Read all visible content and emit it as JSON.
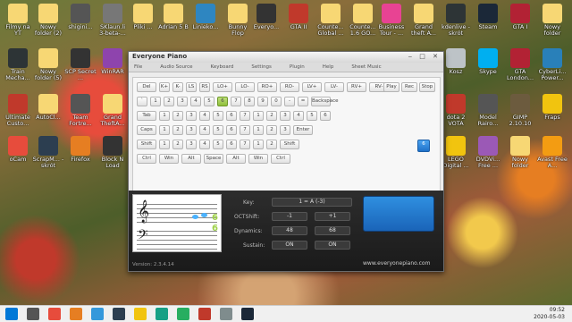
{
  "desktop": {
    "icons": [
      {
        "label": "Filmy na YT",
        "color": "#f7d774"
      },
      {
        "label": "Nowy folder (2)",
        "color": "#f7d774"
      },
      {
        "label": "shigini...",
        "color": "#555"
      },
      {
        "label": "SKlaun.li 3-beta-...",
        "color": "#777"
      },
      {
        "label": "Pliki ...",
        "color": "#f7d774"
      },
      {
        "label": "Adrian 5 B",
        "color": "#f7d774"
      },
      {
        "label": "Linieko...",
        "color": "#2e86c1"
      },
      {
        "label": "Bunny Flop",
        "color": "#f7d774"
      },
      {
        "label": "Everyo...",
        "color": "#333"
      },
      {
        "label": "GTA II",
        "color": "#c0392b"
      },
      {
        "label": "Counte... Global ...",
        "color": "#f7d774"
      },
      {
        "label": "Counte... 1.6 GO...",
        "color": "#f7d774"
      },
      {
        "label": "Business Tour - ...",
        "color": "#e84393"
      },
      {
        "label": "Grand theft A...",
        "color": "#f7d774"
      },
      {
        "label": "kdenlive - skrót",
        "color": "#2d3436"
      },
      {
        "label": "Steam",
        "color": "#1b2838"
      },
      {
        "label": "GTA I",
        "color": "#b22234"
      },
      {
        "label": "Nowy folder",
        "color": "#f7d774"
      },
      {
        "label": "Train Mecha...",
        "color": "#2d3436"
      },
      {
        "label": "Nowy folder (5)",
        "color": "#f7d774"
      },
      {
        "label": "SCP Secret ...",
        "color": "#333"
      },
      {
        "label": "WinRAR",
        "color": "#8e44ad"
      },
      {
        "label": "Kosz",
        "color": "#bdc3c7"
      },
      {
        "label": "Skype",
        "color": "#00aff0"
      },
      {
        "label": "GTA London...",
        "color": "#b22234"
      },
      {
        "label": "CyberLi... Power...",
        "color": "#2980b9"
      },
      {
        "label": "Ultimate Custo...",
        "color": "#c0392b"
      },
      {
        "label": "AutoCl...",
        "color": "#f7d774"
      },
      {
        "label": "Team Fortre...",
        "color": "#555"
      },
      {
        "label": "Grand TheftA...",
        "color": "#f7d774"
      },
      {
        "label": "dota 2 VOTA",
        "color": "#c0392b"
      },
      {
        "label": "Model Rairo...",
        "color": "#555"
      },
      {
        "label": "GIMP 2.10.10",
        "color": "#6c5b3e"
      },
      {
        "label": "Fraps",
        "color": "#f1c40f"
      },
      {
        "label": "oCam",
        "color": "#e74c3c"
      },
      {
        "label": "ScrapM... - skrót",
        "color": "#2c3e50"
      },
      {
        "label": "Firefox",
        "color": "#e67e22"
      },
      {
        "label": "Block N Load",
        "color": "#333"
      },
      {
        "label": "LEGO Digital ...",
        "color": "#f1c40f"
      },
      {
        "label": "DVDVi... Free ...",
        "color": "#9b59b6"
      },
      {
        "label": "Nowy folder",
        "color": "#f7d774"
      },
      {
        "label": "Avast Free A...",
        "color": "#f39c12"
      }
    ]
  },
  "piano": {
    "logo": "Everyone Piano",
    "window_controls": "‒ □ ✕",
    "menu": [
      "File",
      "Audio Source",
      "Keyboard",
      "Settings",
      "Plugin",
      "Help",
      "Sheet Music"
    ],
    "rows": [
      [
        "Del",
        "K+",
        "K-",
        "LS",
        "RS",
        "LO+",
        "LO-",
        "RO+",
        "RO-",
        "LV+",
        "LV-",
        "RV+",
        "RV-"
      ],
      [
        "`",
        "1",
        "2",
        "3",
        "4",
        "5",
        "6",
        "7",
        "8",
        "9",
        "0",
        "-",
        "=",
        "Backspace"
      ],
      [
        "Tab",
        "1",
        "2",
        "3",
        "4",
        "5",
        "6",
        "7",
        "1",
        "2",
        "3",
        "4",
        "5",
        "6"
      ],
      [
        "Caps",
        "1",
        "2",
        "3",
        "4",
        "5",
        "6",
        "7",
        "1",
        "2",
        "3",
        "Enter"
      ],
      [
        "Shift",
        "1",
        "2",
        "3",
        "4",
        "5",
        "6",
        "7",
        "1",
        "2",
        "Shift"
      ],
      [
        "Ctrl",
        "Win",
        "Alt",
        "Space",
        "Alt",
        "Win",
        "Ctrl"
      ]
    ],
    "side_buttons": [
      "Play",
      "Rec",
      "Stop"
    ],
    "active_key": "6",
    "numpad_blue": "6",
    "controls": {
      "key_label": "Key:",
      "key_value": "1 = A (-3)",
      "oct_label": "OCTShift:",
      "oct_left": "-1",
      "oct_right": "+1",
      "dyn_label": "Dynamics:",
      "dyn_left": "48",
      "dyn_right": "68",
      "sustain_label": "Sustain:",
      "sustain_left": "ON",
      "sustain_right": "ON"
    },
    "octave_display": [
      "6",
      "6"
    ],
    "version": "Version: 2.3.4.14",
    "website": "www.everyonepiano.com"
  },
  "taskbar": {
    "icons": [
      "Start",
      "Task View",
      "Chrome",
      "Firefox",
      "Store",
      "Mail",
      "Explorer",
      "Photos",
      "Xbox",
      "Groove",
      "Calculator",
      "Steam"
    ],
    "time": "09:52",
    "date": "2020-05-03"
  }
}
